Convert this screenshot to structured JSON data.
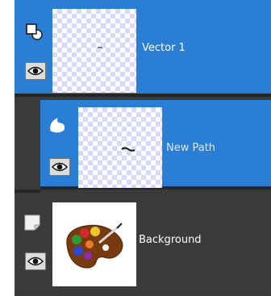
{
  "layers_panel": {
    "layers": [
      {
        "name": "Vector 1",
        "type_icon": "vector-layer-icon",
        "selected": true,
        "visible": true
      },
      {
        "name": "New Path",
        "type_icon": "path-icon",
        "selected": true,
        "visible": true
      },
      {
        "name": "Background",
        "type_icon": "raster-layer-icon",
        "selected": false,
        "visible": true
      }
    ],
    "colors": {
      "selected_row": "#2a7fd4",
      "unselected_row": "#3b3b3b",
      "panel_bg": "#3a3a3a",
      "separator": "#262626",
      "checker": "#d8d8ff"
    }
  }
}
